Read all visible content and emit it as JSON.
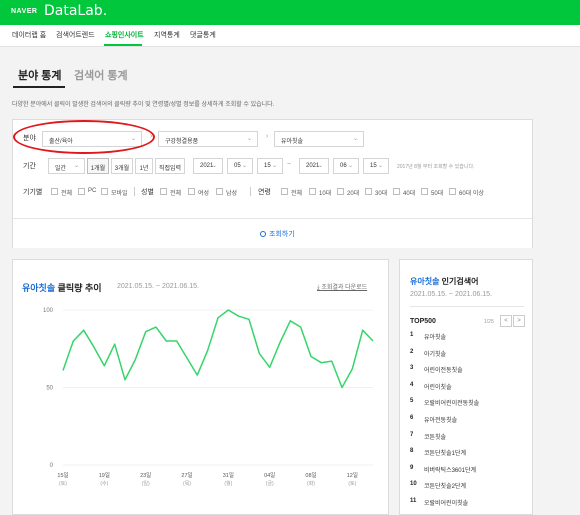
{
  "header": {
    "brand": "NAVER",
    "product": "DataLab."
  },
  "gnb": [
    "데이터랩 홈",
    "검색어트렌드",
    "쇼핑인사이트",
    "지역통계",
    "댓글통계"
  ],
  "tabs": {
    "active": "분야 통계",
    "inactive": "검색어 통계"
  },
  "description": "다양한 분야에서 클릭이 발생한 검색어의 클릭량 추이 및 연령별/성별 정보를 상세하게 조회할 수 있습니다.",
  "filters": {
    "category_label": "분야",
    "category1": "출산/육아",
    "category2": "구강청결용품",
    "category3": "유아칫솔",
    "period_label": "기간",
    "time_unit": "일간",
    "period_buttons": [
      "1개월",
      "3개월",
      "1년",
      "직접입력"
    ],
    "start": {
      "year": "2021",
      "month": "05",
      "day": "15"
    },
    "end": {
      "year": "2021",
      "month": "06",
      "day": "15"
    },
    "period_note": "2017년 8월 부터 조회할 수 있습니다.",
    "device_label": "기기별",
    "device_options": [
      "전체",
      "PC",
      "모바일"
    ],
    "gender_label": "성별",
    "gender_options": [
      "전체",
      "여성",
      "남성"
    ],
    "age_label": "연령",
    "age_options": [
      "전체",
      "10대",
      "20대",
      "30대",
      "40대",
      "50대",
      "60대 이상"
    ],
    "search_button": "조회하기"
  },
  "chart_card": {
    "keyword": "유아칫솔",
    "title_suffix": " 클릭량 추이",
    "period": "2021.05.15. ~ 2021.06.15.",
    "download": "조회결과 다운로드"
  },
  "chart_data": {
    "type": "line",
    "title": "유아칫솔 클릭량 추이",
    "y_ticks": [
      "100",
      "50",
      "0"
    ],
    "ylim": [
      0,
      100
    ],
    "x_labels": [
      {
        "day": "15일",
        "weekday": "(토)"
      },
      {
        "day": "19일",
        "weekday": "(수)"
      },
      {
        "day": "23일",
        "weekday": "(일)"
      },
      {
        "day": "27일",
        "weekday": "(목)"
      },
      {
        "day": "31일",
        "weekday": "(월)"
      },
      {
        "day": "04일",
        "weekday": "(금)"
      },
      {
        "day": "08일",
        "weekday": "(화)"
      },
      {
        "day": "12일",
        "weekday": "(토)"
      }
    ],
    "series": [
      {
        "color": "#36d46a",
        "values": [
          61,
          80,
          87,
          76,
          64,
          78,
          55,
          68,
          86,
          89,
          80,
          80,
          69,
          58,
          74,
          95,
          100,
          96,
          94,
          72,
          63,
          79,
          93,
          89,
          70,
          66,
          67,
          50,
          62,
          87,
          80
        ]
      }
    ]
  },
  "ranking": {
    "keyword": "유아칫솔",
    "title_suffix": " 인기검색어",
    "period": "2021.05.15. ~ 2021.06.15.",
    "top_label": "TOP500",
    "page": "1/25",
    "prev": "<",
    "next": ">",
    "items": [
      {
        "rank": "1",
        "keyword": "유아칫솔"
      },
      {
        "rank": "2",
        "keyword": "아기칫솔"
      },
      {
        "rank": "3",
        "keyword": "어린이전동칫솔"
      },
      {
        "rank": "4",
        "keyword": "어린이칫솔"
      },
      {
        "rank": "5",
        "keyword": "오랄비어린이전동칫솔"
      },
      {
        "rank": "6",
        "keyword": "유아전동칫솔"
      },
      {
        "rank": "7",
        "keyword": "코튼칫솔"
      },
      {
        "rank": "8",
        "keyword": "코튼단칫솔1단계"
      },
      {
        "rank": "9",
        "keyword": "비버락틱스3601단계"
      },
      {
        "rank": "10",
        "keyword": "코튼단칫솔2단계"
      },
      {
        "rank": "11",
        "keyword": "오랄비어린이칫솔"
      }
    ]
  }
}
